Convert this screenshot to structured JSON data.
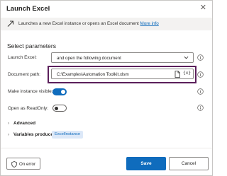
{
  "dialog": {
    "title": "Launch Excel",
    "close_icon": "close-icon"
  },
  "description": {
    "text": "Launches a new Excel instance or opens an Excel document",
    "link": "More info",
    "icon": "excel-launch-icon"
  },
  "parameters": {
    "section_title": "Select parameters",
    "launch_excel": {
      "label": "Launch Excel:",
      "value": "and open the following document"
    },
    "document_path": {
      "label": "Document path:",
      "value": "C:\\Examples\\Automation Toolkit.xlsm",
      "var_button": "{x}"
    },
    "make_visible": {
      "label": "Make instance visible:",
      "checked": true
    },
    "read_only": {
      "label": "Open as ReadOnly:",
      "checked": false
    }
  },
  "advanced": {
    "label": "Advanced"
  },
  "variables_produced": {
    "label": "Variables produced",
    "badge": "ExcelInstance"
  },
  "footer": {
    "on_error": "On error",
    "save": "Save",
    "cancel": "Cancel"
  },
  "colors": {
    "accent": "#0f6cbd",
    "highlight_border": "#5b1f5b"
  }
}
